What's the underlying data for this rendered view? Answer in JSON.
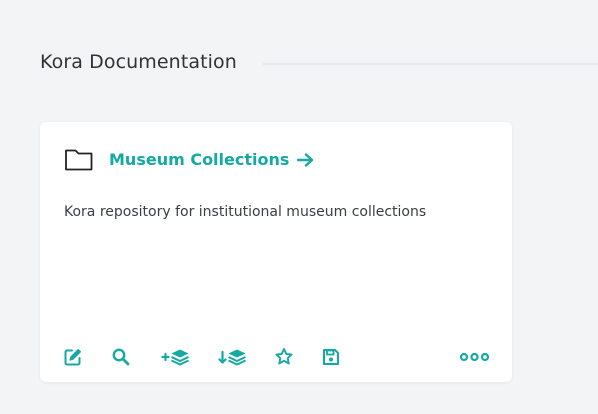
{
  "section": {
    "title": "Kora Documentation"
  },
  "card": {
    "project_name": "Museum Collections",
    "description": "Kora repository for institutional museum collections",
    "icons": {
      "folder": "folder-icon",
      "arrow": "arrow-right-icon",
      "actions": [
        "edit-icon",
        "search-icon",
        "add-layers-icon",
        "import-layers-icon",
        "star-icon",
        "save-icon",
        "more-icon"
      ]
    }
  },
  "colors": {
    "accent": "#14a9a2",
    "background": "#f3f4f6",
    "card": "#ffffff",
    "text": "#2f3338"
  }
}
